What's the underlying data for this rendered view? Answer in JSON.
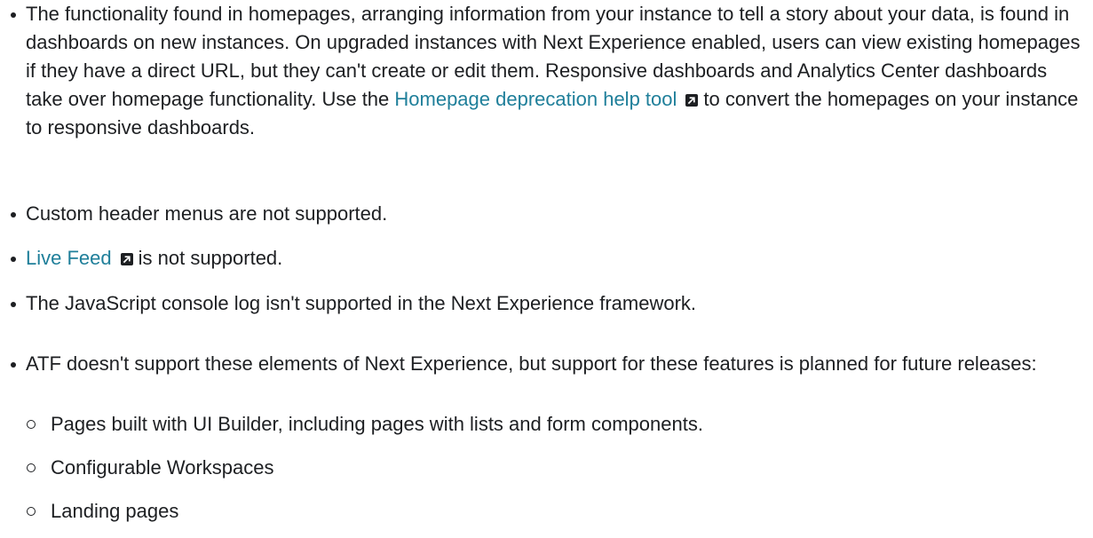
{
  "bullets": {
    "homepages": {
      "text_before_link": "The functionality found in homepages, arranging information from your instance to tell a story about your data, is found in dashboards on new instances. On upgraded instances with Next Experience enabled, users can view existing homepages if they have a direct URL, but they can't create or edit them. Responsive dashboards and Analytics Center dashboards take over homepage functionality. Use the ",
      "link_text": "Homepage deprecation help tool",
      "link_icon": "external-link-icon",
      "text_after_link": "to convert the homepages on your instance to responsive dashboards."
    },
    "custom_header": {
      "text": "Custom header menus are not supported."
    },
    "live_feed": {
      "link_text": "Live Feed",
      "link_icon": "external-link-icon",
      "text_after_link": "is not supported."
    },
    "js_console": {
      "text": "The JavaScript console log isn't supported in the Next Experience framework."
    },
    "atf": {
      "text": "ATF doesn't support these elements of Next Experience, but support for these features is planned for future releases:",
      "sub_items": [
        "Pages built with UI Builder, including pages with lists and form components.",
        "Configurable Workspaces",
        "Landing pages"
      ]
    }
  },
  "colors": {
    "text": "#1d1f22",
    "link": "#1f7f9a",
    "background": "#ffffff"
  }
}
